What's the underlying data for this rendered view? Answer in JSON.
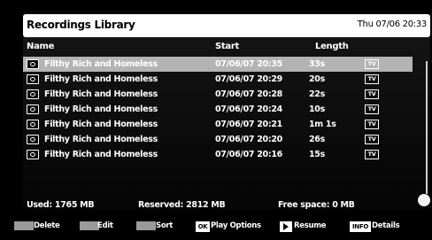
{
  "header": {
    "title": "Recordings Library",
    "clock": "Thu 07/06 20:33"
  },
  "columns": {
    "name": "Name",
    "start": "Start",
    "length": "Length"
  },
  "recordings": [
    {
      "name": "Filthy Rich and Homeless",
      "start": "07/06/07  20:35",
      "length": "33s",
      "type": "TV",
      "selected": true
    },
    {
      "name": "Filthy Rich and Homeless",
      "start": "07/06/07  20:29",
      "length": "20s",
      "type": "TV"
    },
    {
      "name": "Filthy Rich and Homeless",
      "start": "07/06/07  20:28",
      "length": "22s",
      "type": "TV"
    },
    {
      "name": "Filthy Rich and Homeless",
      "start": "07/06/07  20:24",
      "length": "10s",
      "type": "TV"
    },
    {
      "name": "Filthy Rich and Homeless",
      "start": "07/06/07  20:21",
      "length": "1m 1s",
      "type": "TV"
    },
    {
      "name": "Filthy Rich and Homeless",
      "start": "07/06/07  20:20",
      "length": "26s",
      "type": "TV"
    },
    {
      "name": "Filthy Rich and Homeless",
      "start": "07/06/07  20:16",
      "length": "15s",
      "type": "TV"
    }
  ],
  "status": {
    "used": "Used: 1765 MB",
    "reserved": "Reserved: 2812 MB",
    "free": "Free space: 0 MB"
  },
  "footer": {
    "delete": "Delete",
    "edit": "Edit",
    "sort": "Sort",
    "ok_key": "OK",
    "play_options": "Play Options",
    "resume": "Resume",
    "info_key": "INFO",
    "details": "Details"
  },
  "colors": {
    "selected_row": "#b3b3b3",
    "title_bar": "#ffffff",
    "background": "#000000",
    "color_key": "#9a9a9a"
  },
  "icons": {
    "recording": "record-icon",
    "tv": "tv-icon",
    "resume": "play-icon"
  }
}
